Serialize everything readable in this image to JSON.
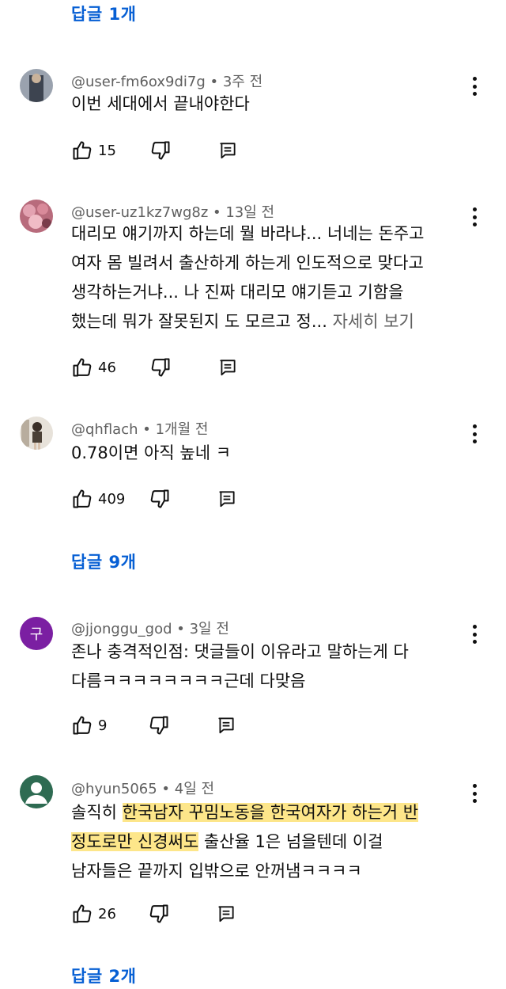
{
  "top_reply": {
    "label": "답글 1개"
  },
  "comments": [
    {
      "author": "@user-fm6ox9di7g",
      "time": "3주 전",
      "lines": [
        "이번 세대에서 끝내야한다"
      ],
      "likes": "15",
      "avatar_colors": [
        "#9aa2ae",
        "#3d4450"
      ]
    },
    {
      "author": "@user-uz1kz7wg8z",
      "time": "13일 전",
      "lines": [
        "대리모 얘기까지 하는데 뭘 바라냐... 너네는 돈주고",
        "여자 몸 빌려서 출산하게 하는게 인도적으로 맞다고",
        "생각하는거냐... 나 진짜 대리모 얘기듣고 기함을",
        "했는데 뭐가 잘못된지 도 모르고 정..."
      ],
      "more": "자세히 보기",
      "likes": "46",
      "avatar_colors": [
        "#d98a9a",
        "#7a3b4a"
      ]
    },
    {
      "author": "@qhflach",
      "time": "1개월 전",
      "lines": [
        "0.78이면 아직 높네 ㅋ"
      ],
      "likes": "409",
      "avatar_colors": [
        "#d8d2c8",
        "#4a4036"
      ]
    },
    {
      "author": "@jjonggu_god",
      "time": "3일 전",
      "lines": [
        "존나 충격적인점: 댓글들이 이유라고 말하는게 다",
        "다름ㅋㅋㅋㅋㅋㅋㅋㅋ근데 다맞음"
      ],
      "likes": "9",
      "avatar_letter": "구",
      "avatar_color": "#7b1fa2"
    },
    {
      "author": "@hyun5065",
      "time": "4일 전",
      "line1": {
        "plain": "솔직히 ",
        "highlight": "한국남자 꾸밈노동을 한국여자가 하는거 반"
      },
      "line2": {
        "highlight": "정도로만 신경써도",
        "plain": " 출산율 1은 넘을텐데 이걸"
      },
      "line3": "남자들은 끝까지 입밖으로 안꺼냄ㅋㅋㅋㅋ",
      "likes": "26",
      "avatar_color": "#2e6b52"
    }
  ],
  "replies_9": {
    "label": "답글 9개"
  },
  "replies_2": {
    "label": "답글 2개"
  },
  "separator": " • ",
  "icons": {
    "like": "thumb-up-icon",
    "dislike": "thumb-down-icon",
    "reply": "reply-comment-icon",
    "more": "more-vertical-icon"
  }
}
